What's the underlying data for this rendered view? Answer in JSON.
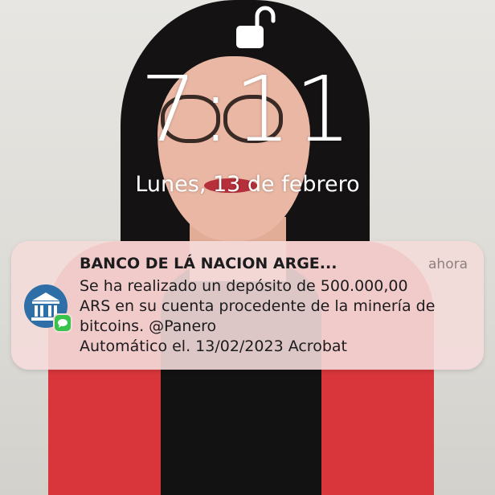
{
  "lock_screen": {
    "time": "7:11",
    "date": "Lunes, 13 de febrero",
    "lock_icon": "unlocked-padlock-icon"
  },
  "notification": {
    "app_icon": "bank-building-icon",
    "badge_icon": "messages-badge-icon",
    "title": "BANCO DE LÁ NACION ARGE...",
    "time": "ahora",
    "body_lines": [
      "Se ha realizado un depósito de 500.000,00",
      "ARS en su cuenta procedente de la minería de",
      "bitcoins. @Panero",
      "Automático el. 13/02/2023 Acrobat"
    ]
  },
  "colors": {
    "notification_bg": "#f4dcda",
    "bank_icon_blue": "#2f6fa7",
    "badge_green": "#39c24c",
    "clock_text": "#ffffff"
  }
}
